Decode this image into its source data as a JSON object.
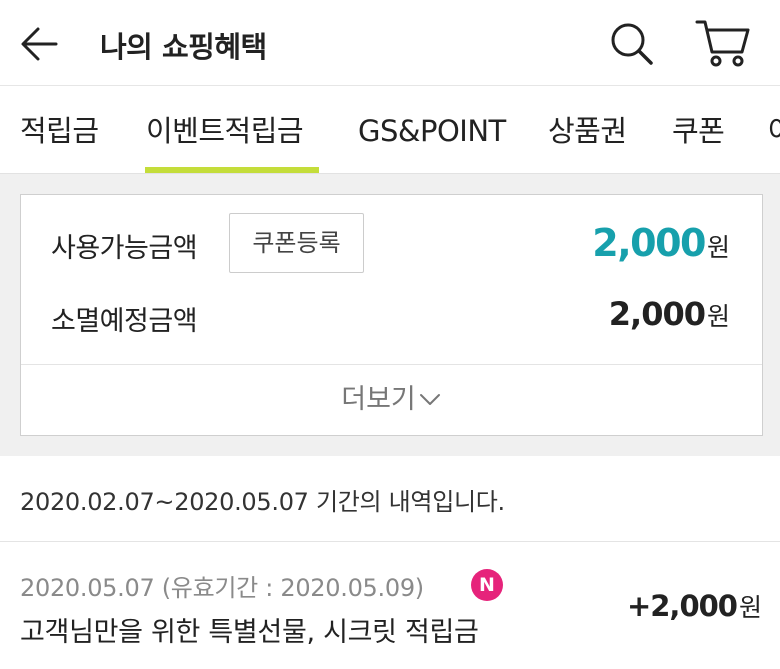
{
  "header": {
    "title": "나의 쇼핑혜택",
    "back_icon": "arrow-left-icon",
    "search_icon": "search-icon",
    "cart_icon": "cart-icon"
  },
  "tabs": [
    {
      "label": "적립금",
      "active": false
    },
    {
      "label": "이벤트적립금",
      "active": true
    },
    {
      "label": "GS&POINT",
      "active": false
    },
    {
      "label": "상품권",
      "active": false
    },
    {
      "label": "쿠폰",
      "active": false
    },
    {
      "label": "어",
      "active": false
    }
  ],
  "summary": {
    "available_label": "사용가능금액",
    "coupon_register_label": "쿠폰등록",
    "available_amount": "2,000",
    "currency": "원",
    "expiring_label": "소멸예정금액",
    "expiring_amount": "2,000",
    "more_label": "더보기"
  },
  "period_notice": "2020.02.07~2020.05.07 기간의 내역입니다.",
  "history": [
    {
      "date_line": "2020.05.07 (유효기간 : 2020.05.09)",
      "badge": "N",
      "title": "고객님만을 위한 특별선물, 시크릿 적립금",
      "amount": "+2,000",
      "currency": "원"
    }
  ],
  "colors": {
    "accent_teal": "#17a0ac",
    "tab_underline": "#c4dd3a",
    "new_badge": "#e6237b"
  }
}
